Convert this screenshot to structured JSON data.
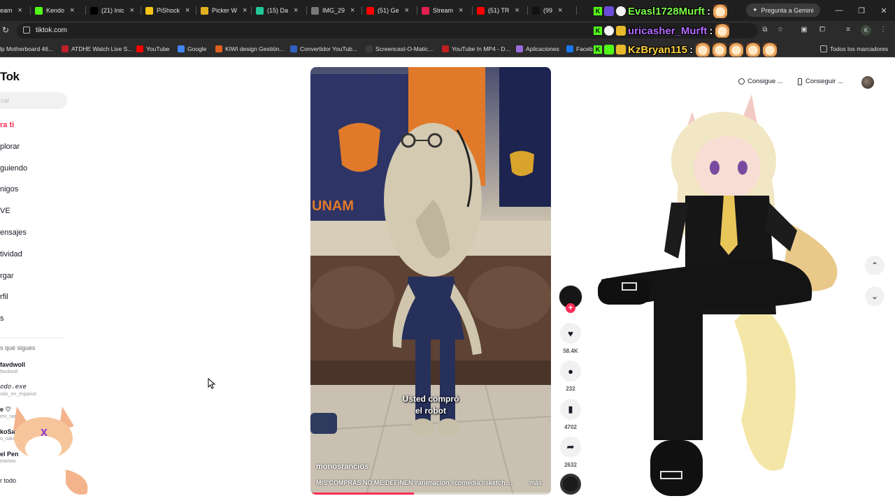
{
  "browser": {
    "tabs": [
      {
        "label": "eam",
        "icon_color": "#53fc18",
        "icon": "kick-icon"
      },
      {
        "label": "Kendo",
        "icon_color": "#53fc18",
        "icon": "kick-icon"
      },
      {
        "label": "(21) Inic",
        "icon_color": "#000000",
        "icon": "x-icon"
      },
      {
        "label": "PiShock",
        "icon_color": "#f5c518",
        "icon": "bolt-icon"
      },
      {
        "label": "Picker W",
        "icon_color": "#e0b020",
        "icon": "picker-icon"
      },
      {
        "label": "(15) Da",
        "icon_color": "#20c997",
        "icon": "discord-icon"
      },
      {
        "label": "IMG_29",
        "icon_color": "#777777",
        "icon": "globe-icon"
      },
      {
        "label": "(51) Ge",
        "icon_color": "#ff0000",
        "icon": "youtube-icon"
      },
      {
        "label": "Stream",
        "icon_color": "#e02050",
        "icon": "streamlabs-icon"
      },
      {
        "label": "(51) TR",
        "icon_color": "#ff0000",
        "icon": "youtube-icon"
      },
      {
        "label": "(99",
        "icon_color": "#111111",
        "icon": "tiktok-icon"
      }
    ],
    "gemini_label": "Pregunta a Gemini",
    "url": "tiktok.com",
    "profile_initial": "K",
    "bookmarks": [
      "lp Motherboard 46...",
      "ATDHE Watch Live S...",
      "YouTube",
      "Google",
      "KIWI design Gestión...",
      "Convertidor YouTub...",
      "Screencast-O-Matic...",
      "YouTube In MP4 - D...",
      "Aplicaciones",
      "Faceb"
    ],
    "bookmarks_all": "Todos los marcadores"
  },
  "stream_overlay": {
    "chat": [
      {
        "user": "Evasl1728Murft",
        "color": "#7dff4a"
      },
      {
        "user": "uricasher_Murft",
        "color": "#b36bff"
      },
      {
        "user": "KzBryan115",
        "color": "#ffd23f"
      }
    ],
    "separator": ":"
  },
  "tiktok": {
    "logo": "Tok",
    "search_placeholder": "car",
    "nav": [
      {
        "label": "ra ti",
        "active": true
      },
      {
        "label": "plorar",
        "active": false
      },
      {
        "label": "guiendo",
        "active": false
      },
      {
        "label": "nigos",
        "active": false
      },
      {
        "label": "VE",
        "active": false
      },
      {
        "label": "ensajes",
        "active": false
      },
      {
        "label": "tividad",
        "active": false
      },
      {
        "label": "rgar",
        "active": false
      },
      {
        "label": "rfil",
        "active": false
      },
      {
        "label": "s",
        "active": false
      }
    ],
    "following_title": "s que sigues",
    "following": [
      {
        "name": "favdwoll",
        "handle": "favdwoll"
      },
      {
        "name": "odo.exe",
        "handle": "odo_en_espanol"
      },
      {
        "name": "e ♡",
        "handle": "eni_san"
      },
      {
        "name": "koSak",
        "handle": "o_sakura"
      },
      {
        "name": "el Pen",
        "handle": "eiartwo"
      }
    ],
    "see_all": "r todo",
    "top_actions": {
      "coins": "Consigue ...",
      "app": "Conseguir ..."
    },
    "video": {
      "caption_line1": "Usted compró",
      "caption_line2": "el robot",
      "author": "monosrancios",
      "description": "MIS COMPRAS NO ME DEFINEN #animacion #comedia #sketch ...",
      "more": "más",
      "progress": 0.43
    },
    "actions": {
      "likes": "58.4K",
      "comments": "232",
      "saves": "4702",
      "shares": "2632"
    }
  }
}
